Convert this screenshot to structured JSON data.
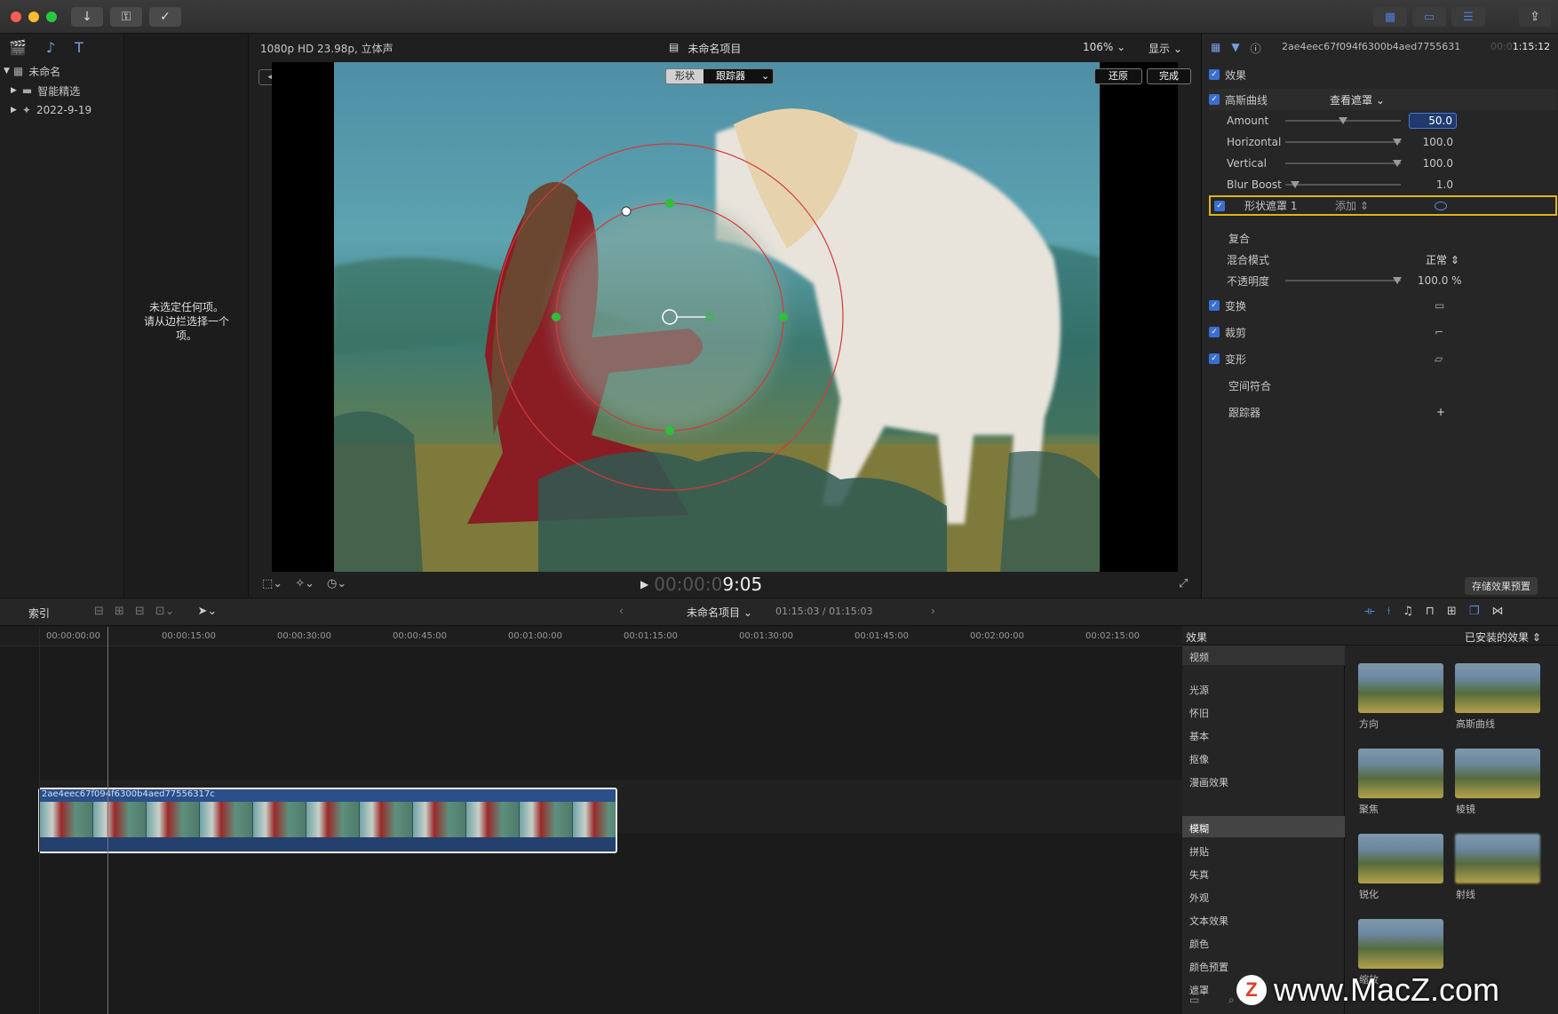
{
  "toolbar": {
    "import_icon": "download-arrow",
    "keywords_icon": "key",
    "check_icon": "checkmark-circle"
  },
  "library": {
    "root": "未命名",
    "items": [
      "智能精选",
      "2022-9-19"
    ]
  },
  "browser": {
    "empty_message": "未选定任何项。\n请从边栏选择一个项。"
  },
  "viewer": {
    "format": "1080p HD 23.98p, 立体声",
    "project_title": "未命名项目",
    "zoom": "106%",
    "display_label": "显示",
    "shape_label": "形状",
    "tracker_label": "跟踪器",
    "reset_label": "还原",
    "done_label": "完成",
    "timecode_dim": "00:00:0",
    "timecode": "9:05"
  },
  "inspector": {
    "clip_name": "2ae4eec67f094f6300b4aed77556317c",
    "duration_dim": "00:0",
    "duration": "1:15:12",
    "effects_label": "效果",
    "gaussian_label": "高斯曲线",
    "view_mask_label": "查看遮罩",
    "params": [
      {
        "name": "Amount",
        "value": "50.0"
      },
      {
        "name": "Horizontal",
        "value": "100.0"
      },
      {
        "name": "Vertical",
        "value": "100.0"
      },
      {
        "name": "Blur Boost",
        "value": "1.0"
      }
    ],
    "shape_mask_label": "形状遮罩 1",
    "add_label": "添加",
    "composite_label": "复合",
    "blend_mode_label": "混合模式",
    "blend_mode_value": "正常",
    "opacity_label": "不透明度",
    "opacity_value": "100.0 %",
    "transform_label": "变换",
    "crop_label": "裁剪",
    "distort_label": "变形",
    "spatial_label": "空间符合",
    "tracker_label": "跟踪器",
    "save_preset_label": "存储效果预置"
  },
  "timeline": {
    "index_label": "索引",
    "project_label": "未命名项目",
    "duration_display": "01:15:03 / 01:15:03",
    "ruler": [
      "00:00:00:00",
      "00:00:15:00",
      "00:00:30:00",
      "00:00:45:00",
      "00:01:00:00",
      "00:01:15:00",
      "00:01:30:00",
      "00:01:45:00",
      "00:02:00:00",
      "00:02:15:00"
    ],
    "clip_name": "2ae4eec67f094f6300b4aed77556317c"
  },
  "effects_browser": {
    "title": "效果",
    "installed_label": "已安装的效果",
    "categories": [
      "视频",
      "光源",
      "怀旧",
      "基本",
      "抠像",
      "漫画效果",
      "模糊",
      "拼贴",
      "失真",
      "外观",
      "文本效果",
      "颜色",
      "颜色预置",
      "遮罩"
    ],
    "thumbs": [
      "方向",
      "高斯曲线",
      "聚焦",
      "棱镜",
      "锐化",
      "射线",
      "缩放"
    ]
  },
  "watermark": {
    "text": "www.MacZ.com"
  }
}
